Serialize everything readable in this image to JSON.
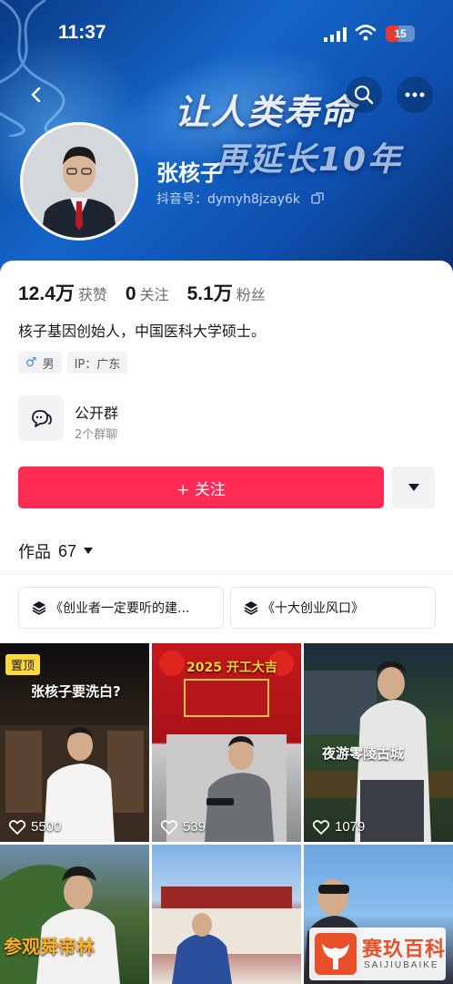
{
  "status_bar": {
    "time": "11:37",
    "battery": "15"
  },
  "banner": {
    "slogan_line1": "让人类寿命",
    "slogan_line2": "再延长10年"
  },
  "profile": {
    "name": "张核子",
    "douyin_id": "抖音号：dymyh8jzay6k",
    "stats": [
      {
        "value": "12.4万",
        "label": "获赞"
      },
      {
        "value": "0",
        "label": "关注"
      },
      {
        "value": "5.1万",
        "label": "粉丝"
      }
    ],
    "bio": "核子基因创始人，中国医科大学硕士。",
    "tags": {
      "gender": "男",
      "ip": "IP：广东"
    }
  },
  "group": {
    "title": "公开群",
    "subtitle": "2个群聊"
  },
  "actions": {
    "follow_label": "+ 关注"
  },
  "works": {
    "label": "作品",
    "count": "67"
  },
  "collections": [
    {
      "label": "《创业者一定要听的建..."
    },
    {
      "label": "《十大创业风口》"
    }
  ],
  "videos": [
    {
      "pinned": "置顶",
      "caption": "张核子要洗白?",
      "likes": "5500"
    },
    {
      "caption": "2025 开工大吉",
      "likes": "539"
    },
    {
      "caption": "夜游零陵古城",
      "likes": "1079"
    },
    {
      "caption": "参观舜帝林"
    },
    {
      "caption": ""
    },
    {
      "caption": ""
    }
  ],
  "watermark": {
    "title": "赛玖百科",
    "subtitle": "SAIJIUBAIKE"
  },
  "colors": {
    "accent": "#fe2c55",
    "banner": "#1465c9"
  }
}
